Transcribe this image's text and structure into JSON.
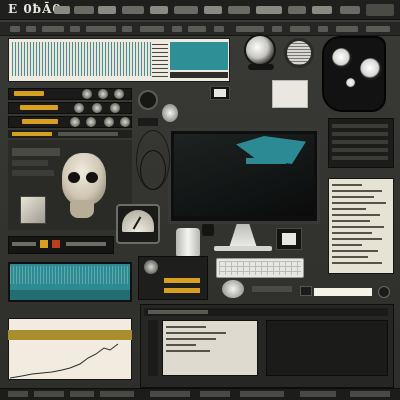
{
  "header": {
    "logo_text": "E 0ƀĀ0"
  },
  "icons": {
    "menu": [
      "menu-pill"
    ],
    "skull": "skull-illustration-icon",
    "monitor": "monitor-icon",
    "camera": "camera-device-icon",
    "gauge": "gauge-icon",
    "keyboard": "keyboard-icon"
  },
  "colors": {
    "background": "#2a2a27",
    "teal": "#2e8a92",
    "orange": "#d8a020",
    "paper": "#eeeae0",
    "gold": "#a88e2e"
  }
}
